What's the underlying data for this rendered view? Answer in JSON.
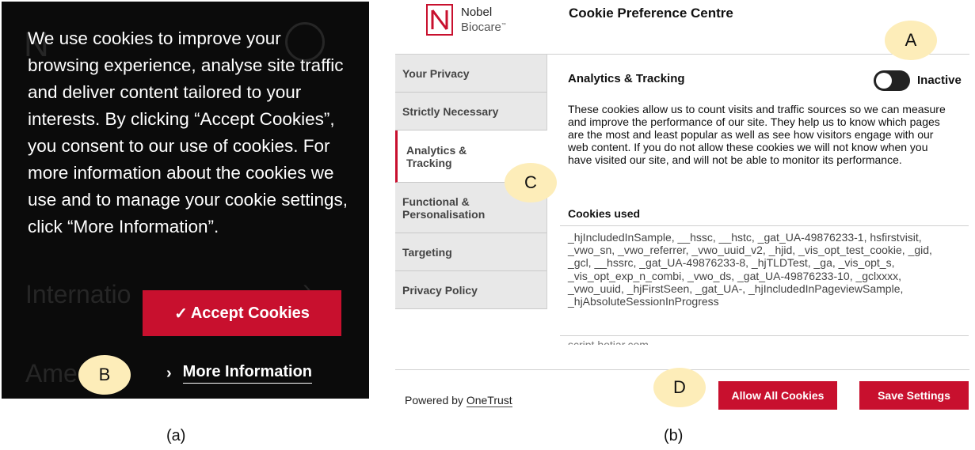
{
  "panel_a": {
    "background_text": [
      "Internatio",
      "Ame"
    ],
    "banner_text": "We use cookies to improve your browsing experience, analyse site traffic and deliver content tailored to your interests. By clicking “Accept Cookies”, you consent to our use of cookies. For more information about the cookies we use and to manage your cookie settings, click “More Information”.",
    "accept_button": "Accept Cookies",
    "accept_icon": "✓",
    "more_info_chevron": "›",
    "more_info_link": "More Information",
    "callout": "B",
    "caption": "(a)"
  },
  "panel_b": {
    "logo": {
      "line1": "Nobel",
      "line2": "Biocare",
      "tm": "™"
    },
    "title": "Cookie Preference Centre",
    "nav": [
      "Your Privacy",
      "Strictly Necessary",
      "Analytics & Tracking",
      "Functional & Personalisation",
      "Targeting",
      "Privacy Policy"
    ],
    "active_nav_index": 2,
    "section_title": "Analytics & Tracking",
    "toggle_state": "Inactive",
    "description": "These cookies allow us to count visits and traffic sources so we can measure and improve the performance of our site. They help us to know which pages are the most and least popular as well as see how visitors engage with our web content. If you do not allow these cookies we will not know when you have visited our site, and will not be able to monitor its performance.",
    "cookies_used_label": "Cookies used",
    "cookies_list": "_hjIncludedInSample, __hssc, __hstc, _gat_UA-49876233-1, hsfirstvisit, _vwo_sn, _vwo_referrer, _vwo_uuid_v2, _hjid, _vis_opt_test_cookie, _gid, _gcl, __hssrc, _gat_UA-49876233-8, _hjTLDTest, _ga, _vis_opt_s, _vis_opt_exp_n_combi, _vwo_ds, _gat_UA-49876233-10, _gclxxxx, _vwo_uuid, _hjFirstSeen, _gat_UA-, _hjIncludedInPageviewSample, _hjAbsoluteSessionInProgress",
    "cookies_next_partial": "script.hotjar.com",
    "powered_by_prefix": "Powered by ",
    "powered_by_link": "OneTrust",
    "allow_all_button": "Allow All Cookies",
    "save_settings_button": "Save Settings",
    "callouts": {
      "a": "A",
      "c": "C",
      "d": "D"
    },
    "caption": "(b)"
  },
  "colors": {
    "brand_red": "#c8102e",
    "callout_fill": "#fdedb9",
    "banner_bg": "#0b0b0b"
  }
}
